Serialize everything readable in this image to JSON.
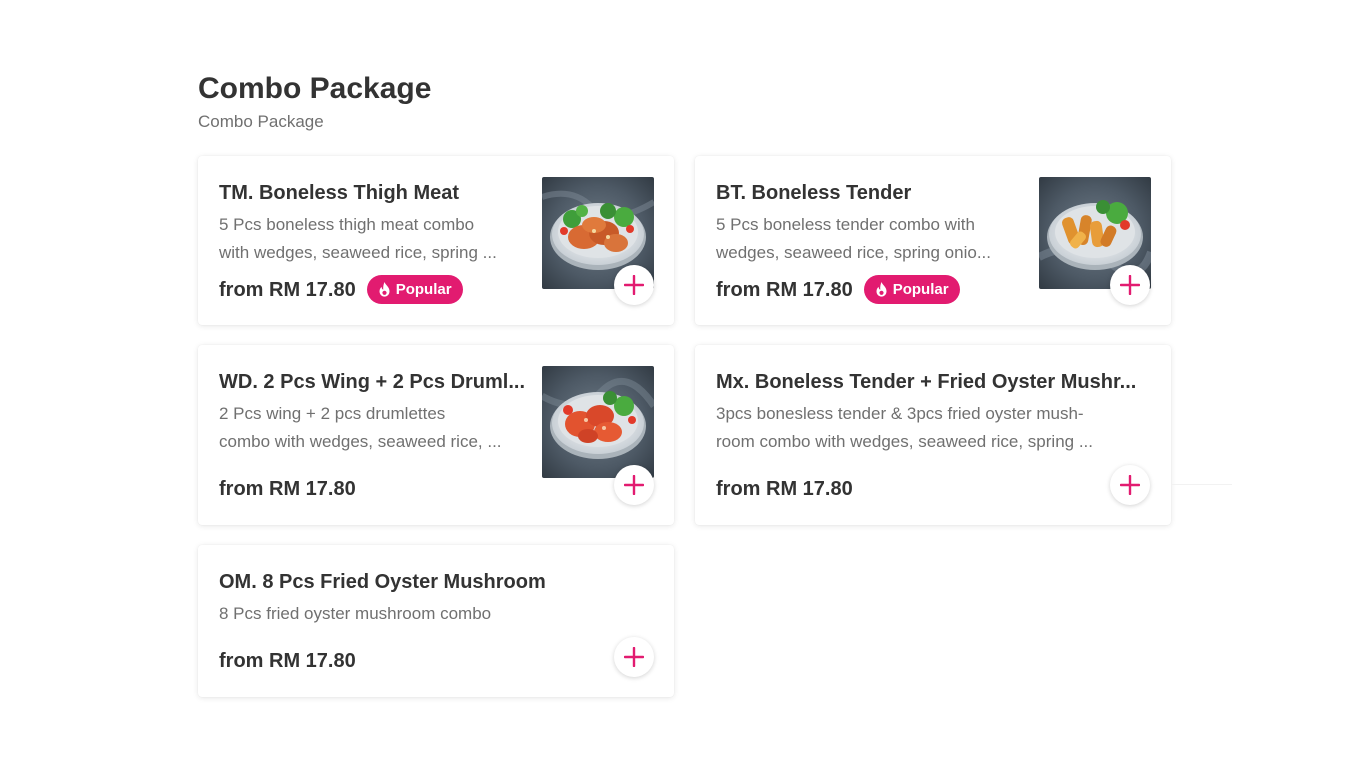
{
  "section": {
    "title": "Combo Package",
    "subtitle": "Combo Package"
  },
  "colors": {
    "accent": "#e21b70",
    "text": "#333333",
    "muted": "#707070"
  },
  "items": [
    {
      "title": "TM. Boneless Thigh Meat",
      "desc_line1": "5 Pcs boneless thigh meat combo",
      "desc_line2": "with wedges, seaweed rice, spring ...",
      "price": "from RM 17.80",
      "badge": "Popular",
      "badge_icon": "flame-icon",
      "image": "food-bowl-thigh-meat",
      "add_icon": "plus-icon"
    },
    {
      "title": "BT. Boneless Tender",
      "desc_line1": "5 Pcs boneless tender combo with",
      "desc_line2": "wedges, seaweed rice, spring onio...",
      "price": "from RM 17.80",
      "badge": "Popular",
      "badge_icon": "flame-icon",
      "image": "food-bowl-tender",
      "add_icon": "plus-icon"
    },
    {
      "title": "WD. 2 Pcs Wing + 2 Pcs Druml...",
      "desc_line1": "2 Pcs wing + 2 pcs drumlettes",
      "desc_line2": "combo with wedges, seaweed rice, ...",
      "price": "from RM 17.80",
      "image": "food-bowl-wings",
      "add_icon": "plus-icon"
    },
    {
      "title": "Mx. Boneless Tender + Fried Oyster Mushr...",
      "desc_line1": "3pcs bonesless tender & 3pcs fried oyster mush-",
      "desc_line2": "room combo with wedges, seaweed rice, spring ...",
      "price": "from RM 17.80",
      "add_icon": "plus-icon"
    },
    {
      "title": "OM. 8 Pcs Fried Oyster Mushroom",
      "desc_line1": "8 Pcs fried oyster mushroom combo",
      "price": "from RM 17.80",
      "add_icon": "plus-icon"
    }
  ]
}
